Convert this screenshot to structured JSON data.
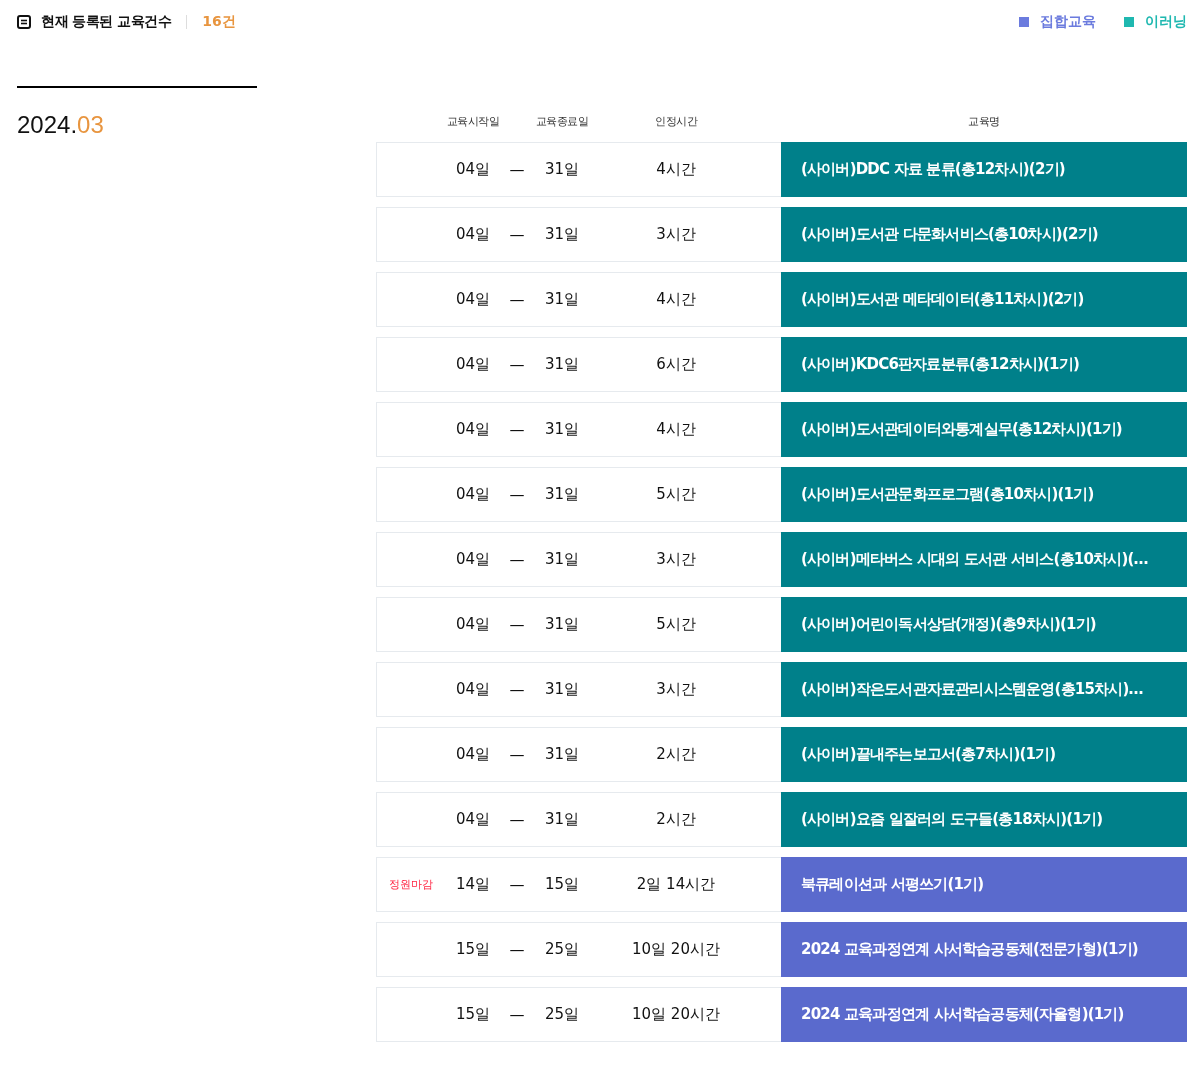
{
  "summary": {
    "label": "현재 등록된 교육건수",
    "count": "16건"
  },
  "legend": [
    {
      "label": "집합교육",
      "color": "#6b7bde"
    },
    {
      "label": "이러닝",
      "color": "#1fb8b0"
    }
  ],
  "period": {
    "year": "2024.",
    "month": "03"
  },
  "table": {
    "columns": [
      "교육시작일",
      "교육종료일",
      "인정시간",
      "교육명"
    ],
    "rows": [
      {
        "kind": "elearning",
        "start": "04일",
        "dash": "—",
        "end": "31일",
        "hours": "4시간",
        "title": "(사이버)DDC 자료 분류(총12차시)(2기)"
      },
      {
        "kind": "elearning",
        "start": "04일",
        "dash": "—",
        "end": "31일",
        "hours": "3시간",
        "title": "(사이버)도서관 다문화서비스(총10차시)(2기)"
      },
      {
        "kind": "elearning",
        "start": "04일",
        "dash": "—",
        "end": "31일",
        "hours": "4시간",
        "title": "(사이버)도서관 메타데이터(총11차시)(2기)"
      },
      {
        "kind": "elearning",
        "start": "04일",
        "dash": "—",
        "end": "31일",
        "hours": "6시간",
        "title": "(사이버)KDC6판자료분류(총12차시)(1기)"
      },
      {
        "kind": "elearning",
        "start": "04일",
        "dash": "—",
        "end": "31일",
        "hours": "4시간",
        "title": "(사이버)도서관데이터와통계실무(총12차시)(1기)"
      },
      {
        "kind": "elearning",
        "start": "04일",
        "dash": "—",
        "end": "31일",
        "hours": "5시간",
        "title": "(사이버)도서관문화프로그램(총10차시)(1기)"
      },
      {
        "kind": "elearning",
        "start": "04일",
        "dash": "—",
        "end": "31일",
        "hours": "3시간",
        "title": "(사이버)메타버스 시대의 도서관 서비스(총10차시)(…"
      },
      {
        "kind": "elearning",
        "start": "04일",
        "dash": "—",
        "end": "31일",
        "hours": "5시간",
        "title": "(사이버)어린이독서상담(개정)(총9차시)(1기)"
      },
      {
        "kind": "elearning",
        "start": "04일",
        "dash": "—",
        "end": "31일",
        "hours": "3시간",
        "title": "(사이버)작은도서관자료관리시스템운영(총15차시)…"
      },
      {
        "kind": "elearning",
        "start": "04일",
        "dash": "—",
        "end": "31일",
        "hours": "2시간",
        "title": "(사이버)끝내주는보고서(총7차시)(1기)"
      },
      {
        "kind": "elearning",
        "start": "04일",
        "dash": "—",
        "end": "31일",
        "hours": "2시간",
        "title": "(사이버)요즘 일잘러의 도구들(총18차시)(1기)"
      },
      {
        "kind": "group",
        "status": "정원마감",
        "start": "14일",
        "dash": "—",
        "end": "15일",
        "hours": "2일 14시간",
        "title": "북큐레이션과 서평쓰기(1기)"
      },
      {
        "kind": "group",
        "start": "15일",
        "dash": "—",
        "end": "25일",
        "hours": "10일 20시간",
        "title": "2024 교육과정연계 사서학습공동체(전문가형)(1기)"
      },
      {
        "kind": "group",
        "start": "15일",
        "dash": "—",
        "end": "25일",
        "hours": "10일 20시간",
        "title": "2024 교육과정연계 사서학습공동체(자율형)(1기)"
      }
    ]
  }
}
